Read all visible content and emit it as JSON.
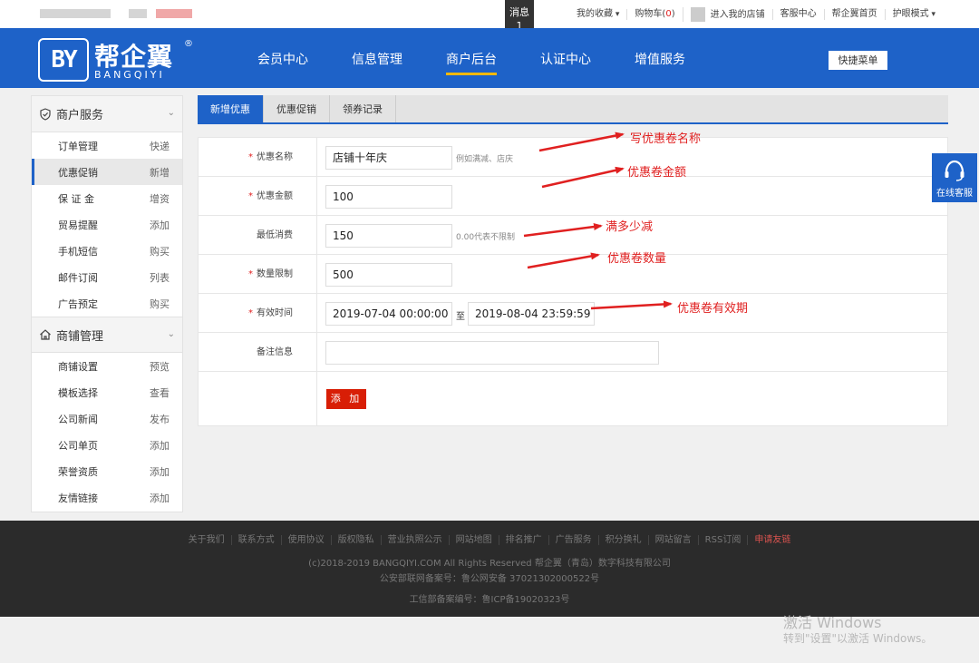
{
  "topbar": {
    "msg_label": "消息",
    "msg_count": "1",
    "favorites": "我的收藏",
    "cart_label": "购物车(",
    "cart_count": "0",
    "cart_close": ")",
    "my_shop": "进入我的店铺",
    "service_center": "客服中心",
    "home": "帮企翼首页",
    "eye_mode": "护眼模式"
  },
  "header": {
    "logo_mark": "BY",
    "logo_name": "帮企翼",
    "logo_reg": "®",
    "logo_sub": "BANGQIYI",
    "nav": [
      {
        "label": "会员中心"
      },
      {
        "label": "信息管理"
      },
      {
        "label": "商户后台"
      },
      {
        "label": "认证中心"
      },
      {
        "label": "增值服务"
      }
    ],
    "quick_menu": "快捷菜单"
  },
  "sidebar": {
    "group1": {
      "title": "商户服务",
      "items": [
        {
          "label": "订单管理",
          "action": "快递"
        },
        {
          "label": "优惠促销",
          "action": "新增"
        },
        {
          "label": "保 证 金",
          "action": "增资"
        },
        {
          "label": "贸易提醒",
          "action": "添加"
        },
        {
          "label": "手机短信",
          "action": "购买"
        },
        {
          "label": "邮件订阅",
          "action": "列表"
        },
        {
          "label": "广告预定",
          "action": "购买"
        }
      ]
    },
    "group2": {
      "title": "商铺管理",
      "items": [
        {
          "label": "商铺设置",
          "action": "预览"
        },
        {
          "label": "模板选择",
          "action": "查看"
        },
        {
          "label": "公司新闻",
          "action": "发布"
        },
        {
          "label": "公司单页",
          "action": "添加"
        },
        {
          "label": "荣誉资质",
          "action": "添加"
        },
        {
          "label": "友情链接",
          "action": "添加"
        }
      ]
    }
  },
  "tabs": [
    {
      "label": "新增优惠"
    },
    {
      "label": "优惠促销"
    },
    {
      "label": "领券记录"
    }
  ],
  "form": {
    "required_mark": "*",
    "name": {
      "label": "优惠名称",
      "value": "店铺十年庆",
      "hint": "例如满减、店庆"
    },
    "amount": {
      "label": "优惠金额",
      "value": "100"
    },
    "min_spend": {
      "label": "最低消费",
      "value": "150",
      "hint": "0.00代表不限制"
    },
    "quantity": {
      "label": "数量限制",
      "value": "500"
    },
    "valid": {
      "label": "有效时间",
      "start": "2019-07-04 00:00:00",
      "sep": "至",
      "end": "2019-08-04 23:59:59"
    },
    "remark": {
      "label": "备注信息",
      "value": ""
    },
    "submit": "添 加"
  },
  "annotations": [
    "写优惠卷名称",
    "优惠卷金额",
    "满多少减",
    "优惠卷数量",
    "优惠卷有效期"
  ],
  "online_service": "在线客服",
  "footer": {
    "links": [
      {
        "label": "关于我们"
      },
      {
        "label": "联系方式"
      },
      {
        "label": "使用协议"
      },
      {
        "label": "版权隐私"
      },
      {
        "label": "营业执照公示"
      },
      {
        "label": "网站地图"
      },
      {
        "label": "排名推广"
      },
      {
        "label": "广告服务"
      },
      {
        "label": "积分换礼"
      },
      {
        "label": "网站留言"
      },
      {
        "label": "RSS订阅"
      },
      {
        "label": "申请友链"
      }
    ],
    "copyright": "(c)2018-2019 BANGQIYI.COM All Rights Reserved 帮企翼（青岛）数字科技有限公司",
    "police": "公安部联网备案号：鲁公网安备 37021302000522号",
    "icp": "工信部备案编号：鲁ICP备19020323号"
  },
  "watermark": {
    "line1": "激活 Windows",
    "line2": "转到\"设置\"以激活 Windows。"
  },
  "colors": {
    "brand_blue": "#1e62c8",
    "accent_red": "#d81e06",
    "nav_underline": "#f5b800"
  }
}
